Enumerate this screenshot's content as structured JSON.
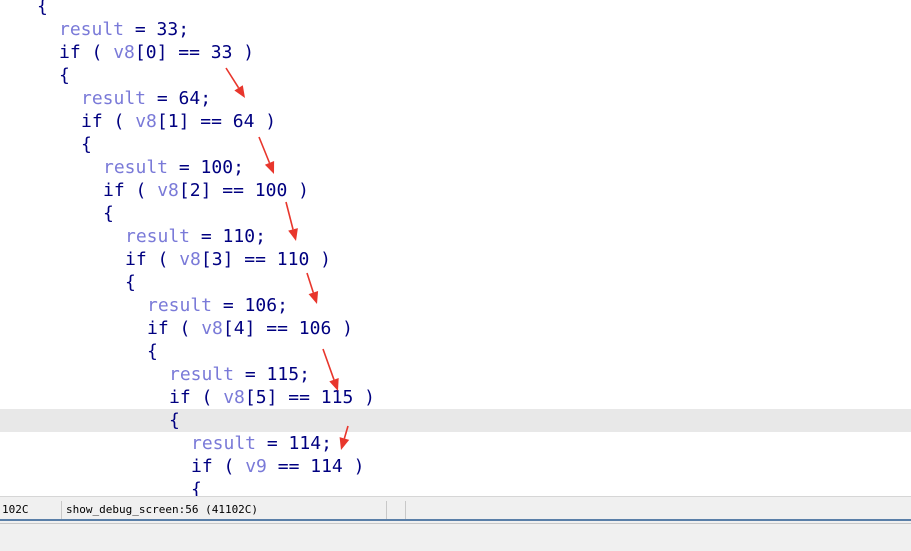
{
  "code_lines": [
    {
      "indent": 0,
      "tokens": [
        {
          "t": "pun",
          "v": "{"
        }
      ]
    },
    {
      "indent": 1,
      "tokens": [
        {
          "t": "var",
          "v": "result"
        },
        {
          "t": "pun",
          "v": " = "
        },
        {
          "t": "num",
          "v": "33"
        },
        {
          "t": "pun",
          "v": ";"
        }
      ]
    },
    {
      "indent": 1,
      "tokens": [
        {
          "t": "kw",
          "v": "if"
        },
        {
          "t": "pun",
          "v": " ( "
        },
        {
          "t": "var",
          "v": "v8"
        },
        {
          "t": "pun",
          "v": "["
        },
        {
          "t": "num",
          "v": "0"
        },
        {
          "t": "pun",
          "v": "] == "
        },
        {
          "t": "num",
          "v": "33"
        },
        {
          "t": "pun",
          "v": " )"
        }
      ]
    },
    {
      "indent": 1,
      "tokens": [
        {
          "t": "pun",
          "v": "{"
        }
      ]
    },
    {
      "indent": 2,
      "tokens": [
        {
          "t": "var",
          "v": "result"
        },
        {
          "t": "pun",
          "v": " = "
        },
        {
          "t": "num",
          "v": "64"
        },
        {
          "t": "pun",
          "v": ";"
        }
      ]
    },
    {
      "indent": 2,
      "tokens": [
        {
          "t": "kw",
          "v": "if"
        },
        {
          "t": "pun",
          "v": " ( "
        },
        {
          "t": "var",
          "v": "v8"
        },
        {
          "t": "pun",
          "v": "["
        },
        {
          "t": "num",
          "v": "1"
        },
        {
          "t": "pun",
          "v": "] == "
        },
        {
          "t": "num",
          "v": "64"
        },
        {
          "t": "pun",
          "v": " )"
        }
      ]
    },
    {
      "indent": 2,
      "tokens": [
        {
          "t": "pun",
          "v": "{"
        }
      ]
    },
    {
      "indent": 3,
      "tokens": [
        {
          "t": "var",
          "v": "result"
        },
        {
          "t": "pun",
          "v": " = "
        },
        {
          "t": "num",
          "v": "100"
        },
        {
          "t": "pun",
          "v": ";"
        }
      ]
    },
    {
      "indent": 3,
      "tokens": [
        {
          "t": "kw",
          "v": "if"
        },
        {
          "t": "pun",
          "v": " ( "
        },
        {
          "t": "var",
          "v": "v8"
        },
        {
          "t": "pun",
          "v": "["
        },
        {
          "t": "num",
          "v": "2"
        },
        {
          "t": "pun",
          "v": "] == "
        },
        {
          "t": "num",
          "v": "100"
        },
        {
          "t": "pun",
          "v": " )"
        }
      ]
    },
    {
      "indent": 3,
      "tokens": [
        {
          "t": "pun",
          "v": "{"
        }
      ]
    },
    {
      "indent": 4,
      "tokens": [
        {
          "t": "var",
          "v": "result"
        },
        {
          "t": "pun",
          "v": " = "
        },
        {
          "t": "num",
          "v": "110"
        },
        {
          "t": "pun",
          "v": ";"
        }
      ]
    },
    {
      "indent": 4,
      "tokens": [
        {
          "t": "kw",
          "v": "if"
        },
        {
          "t": "pun",
          "v": " ( "
        },
        {
          "t": "var",
          "v": "v8"
        },
        {
          "t": "pun",
          "v": "["
        },
        {
          "t": "num",
          "v": "3"
        },
        {
          "t": "pun",
          "v": "] == "
        },
        {
          "t": "num",
          "v": "110"
        },
        {
          "t": "pun",
          "v": " )"
        }
      ]
    },
    {
      "indent": 4,
      "tokens": [
        {
          "t": "pun",
          "v": "{"
        }
      ]
    },
    {
      "indent": 5,
      "tokens": [
        {
          "t": "var",
          "v": "result"
        },
        {
          "t": "pun",
          "v": " = "
        },
        {
          "t": "num",
          "v": "106"
        },
        {
          "t": "pun",
          "v": ";"
        }
      ]
    },
    {
      "indent": 5,
      "tokens": [
        {
          "t": "kw",
          "v": "if"
        },
        {
          "t": "pun",
          "v": " ( "
        },
        {
          "t": "var",
          "v": "v8"
        },
        {
          "t": "pun",
          "v": "["
        },
        {
          "t": "num",
          "v": "4"
        },
        {
          "t": "pun",
          "v": "] == "
        },
        {
          "t": "num",
          "v": "106"
        },
        {
          "t": "pun",
          "v": " )"
        }
      ]
    },
    {
      "indent": 5,
      "tokens": [
        {
          "t": "pun",
          "v": "{"
        }
      ]
    },
    {
      "indent": 6,
      "tokens": [
        {
          "t": "var",
          "v": "result"
        },
        {
          "t": "pun",
          "v": " = "
        },
        {
          "t": "num",
          "v": "115"
        },
        {
          "t": "pun",
          "v": ";"
        }
      ]
    },
    {
      "indent": 6,
      "tokens": [
        {
          "t": "kw",
          "v": "if"
        },
        {
          "t": "pun",
          "v": " ( "
        },
        {
          "t": "var",
          "v": "v8"
        },
        {
          "t": "pun",
          "v": "["
        },
        {
          "t": "num",
          "v": "5"
        },
        {
          "t": "pun",
          "v": "] == "
        },
        {
          "t": "num",
          "v": "115"
        },
        {
          "t": "pun",
          "v": " )"
        }
      ]
    },
    {
      "indent": 6,
      "tokens": [
        {
          "t": "pun",
          "v": "{"
        }
      ],
      "highlighted": true
    },
    {
      "indent": 7,
      "tokens": [
        {
          "t": "var",
          "v": "result"
        },
        {
          "t": "pun",
          "v": " = "
        },
        {
          "t": "num",
          "v": "114"
        },
        {
          "t": "pun",
          "v": ";"
        }
      ]
    },
    {
      "indent": 7,
      "tokens": [
        {
          "t": "kw",
          "v": "if"
        },
        {
          "t": "pun",
          "v": " ( "
        },
        {
          "t": "var",
          "v": "v9"
        },
        {
          "t": "pun",
          "v": " == "
        },
        {
          "t": "num",
          "v": "114"
        },
        {
          "t": "pun",
          "v": " )"
        }
      ]
    },
    {
      "indent": 7,
      "tokens": [
        {
          "t": "pun",
          "v": "{"
        }
      ]
    }
  ],
  "status_bar": {
    "address": "102C",
    "location": "show_debug_screen:56 (41102C)"
  },
  "colors": {
    "keyword": "#000080",
    "variable": "#7a7ad8",
    "highlight_line": "#e8e8e8",
    "annotation_arrow": "#e8362c"
  },
  "icons": [
    "annotation-arrow"
  ]
}
